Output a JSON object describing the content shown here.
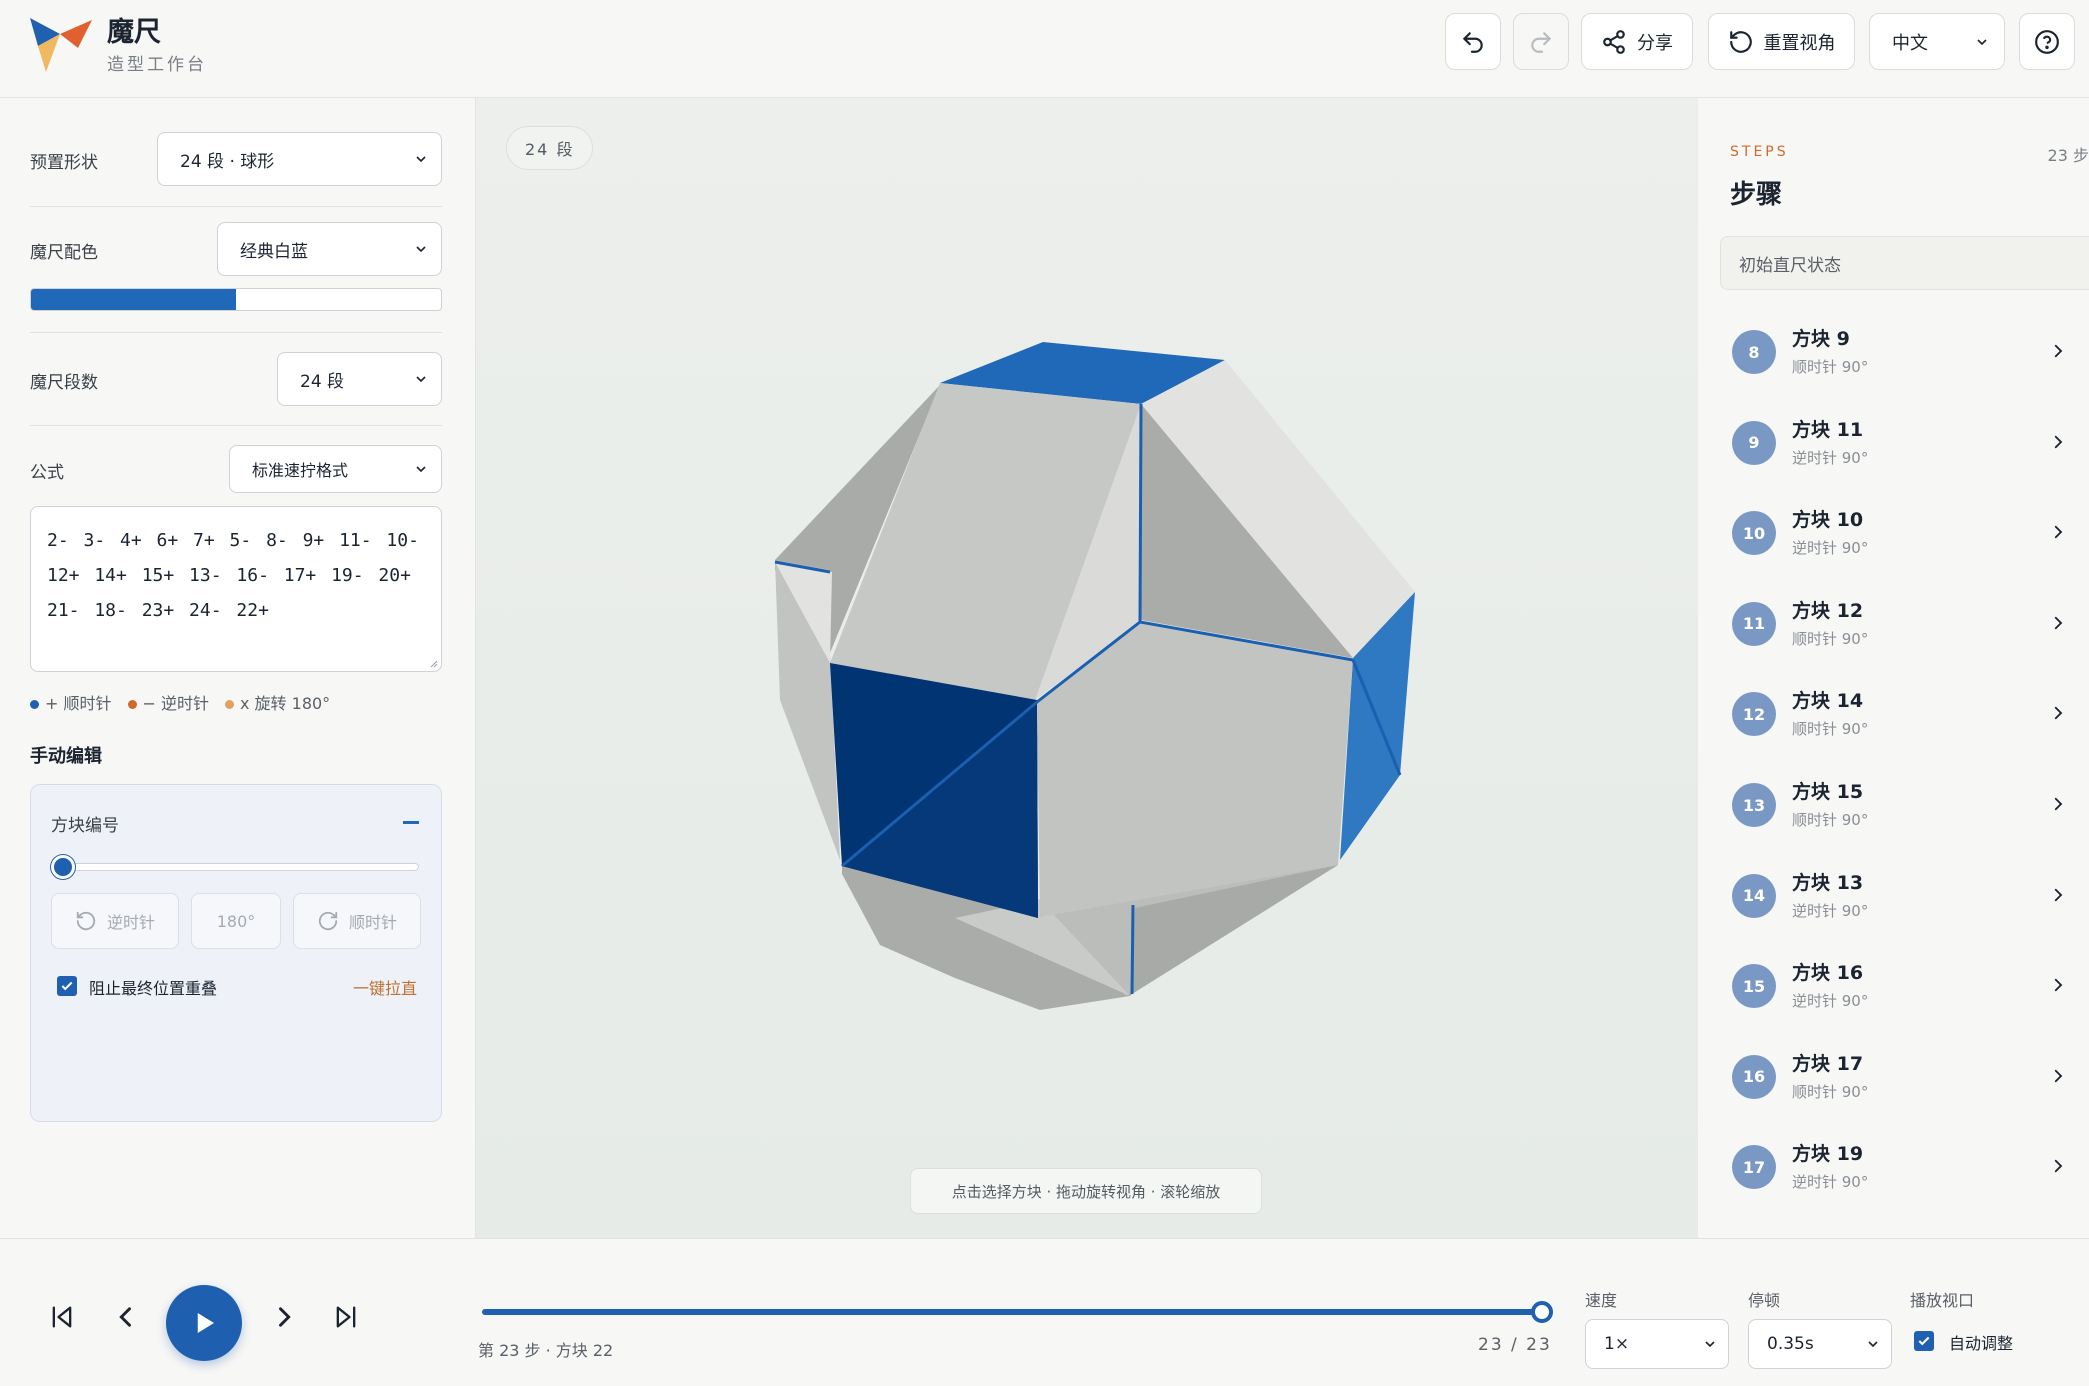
{
  "header": {
    "title": "魔尺",
    "subtitle": "造型工作台",
    "share_label": "分享",
    "reset_view_label": "重置视角",
    "language_value": "中文"
  },
  "left_panel": {
    "preset_label": "预置形状",
    "preset_value": "24 段 · 球形",
    "color_label": "魔尺配色",
    "color_value": "经典白蓝",
    "color_preview": {
      "primary": "#2068b8",
      "secondary": "#ffffff",
      "primary_fraction": 0.5
    },
    "segments_label": "魔尺段数",
    "segments_value": "24 段",
    "formula_label": "公式",
    "formula_format_value": "标准速拧格式",
    "formula_text": "2- 3- 4+ 6+ 7+ 5- 8- 9+ 11- 10- 12+ 14+ 15+ 13- 16- 17+ 19- 20+ 21- 18- 23+ 24- 22+",
    "legend": [
      {
        "label": "+ 顺时针",
        "color": "#2060b0"
      },
      {
        "label": "− 逆时针",
        "color": "#d06a2a"
      },
      {
        "label": "x 旋转 180°",
        "color": "#e0a060"
      }
    ],
    "manual_edit_title": "手动编辑",
    "block_number_label": "方块编号",
    "ccw_label": "逆时针",
    "rot180_label": "180°",
    "cw_label": "顺时针",
    "prevent_overlap_label": "阻止最终位置重叠",
    "straighten_label": "一键拉直"
  },
  "viewport": {
    "segment_badge": "24 段",
    "hint": "点击选择方块 · 拖动旋转视角 · 滚轮缩放"
  },
  "steps_panel": {
    "eyebrow": "STEPS",
    "title": "步骤",
    "count": "23 步",
    "initial_state": "初始直尺状态",
    "items": [
      {
        "num": "8",
        "title": "方块 9",
        "dir": "顺时针 90°"
      },
      {
        "num": "9",
        "title": "方块 11",
        "dir": "逆时针 90°"
      },
      {
        "num": "10",
        "title": "方块 10",
        "dir": "逆时针 90°"
      },
      {
        "num": "11",
        "title": "方块 12",
        "dir": "顺时针 90°"
      },
      {
        "num": "12",
        "title": "方块 14",
        "dir": "顺时针 90°"
      },
      {
        "num": "13",
        "title": "方块 15",
        "dir": "顺时针 90°"
      },
      {
        "num": "14",
        "title": "方块 13",
        "dir": "逆时针 90°"
      },
      {
        "num": "15",
        "title": "方块 16",
        "dir": "逆时针 90°"
      },
      {
        "num": "16",
        "title": "方块 17",
        "dir": "顺时针 90°"
      },
      {
        "num": "17",
        "title": "方块 19",
        "dir": "逆时针 90°"
      }
    ]
  },
  "playback": {
    "current_step_text": "第 23 步 · 方块 22",
    "progress_text": "23 / 23",
    "progress_fraction": 1.0,
    "speed_label": "速度",
    "speed_value": "1×",
    "pause_label": "停顿",
    "pause_value": "0.35s",
    "viewport_label": "播放视口",
    "auto_adjust_label": "自动调整"
  },
  "colors": {
    "accent": "#2060b0",
    "orange": "#d06a2a",
    "puzzle_blue": "#2068b8",
    "puzzle_white": "#d8d9d6"
  }
}
